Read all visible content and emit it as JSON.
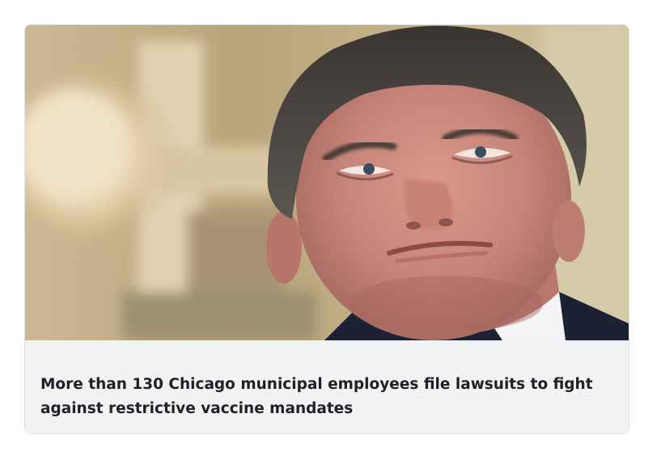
{
  "article": {
    "headline": "More than 130 Chicago municipal employees file lawsuits to fight against restrictive vaccine mandates",
    "image": {
      "subject_icon": "person-portrait-photo"
    }
  }
}
